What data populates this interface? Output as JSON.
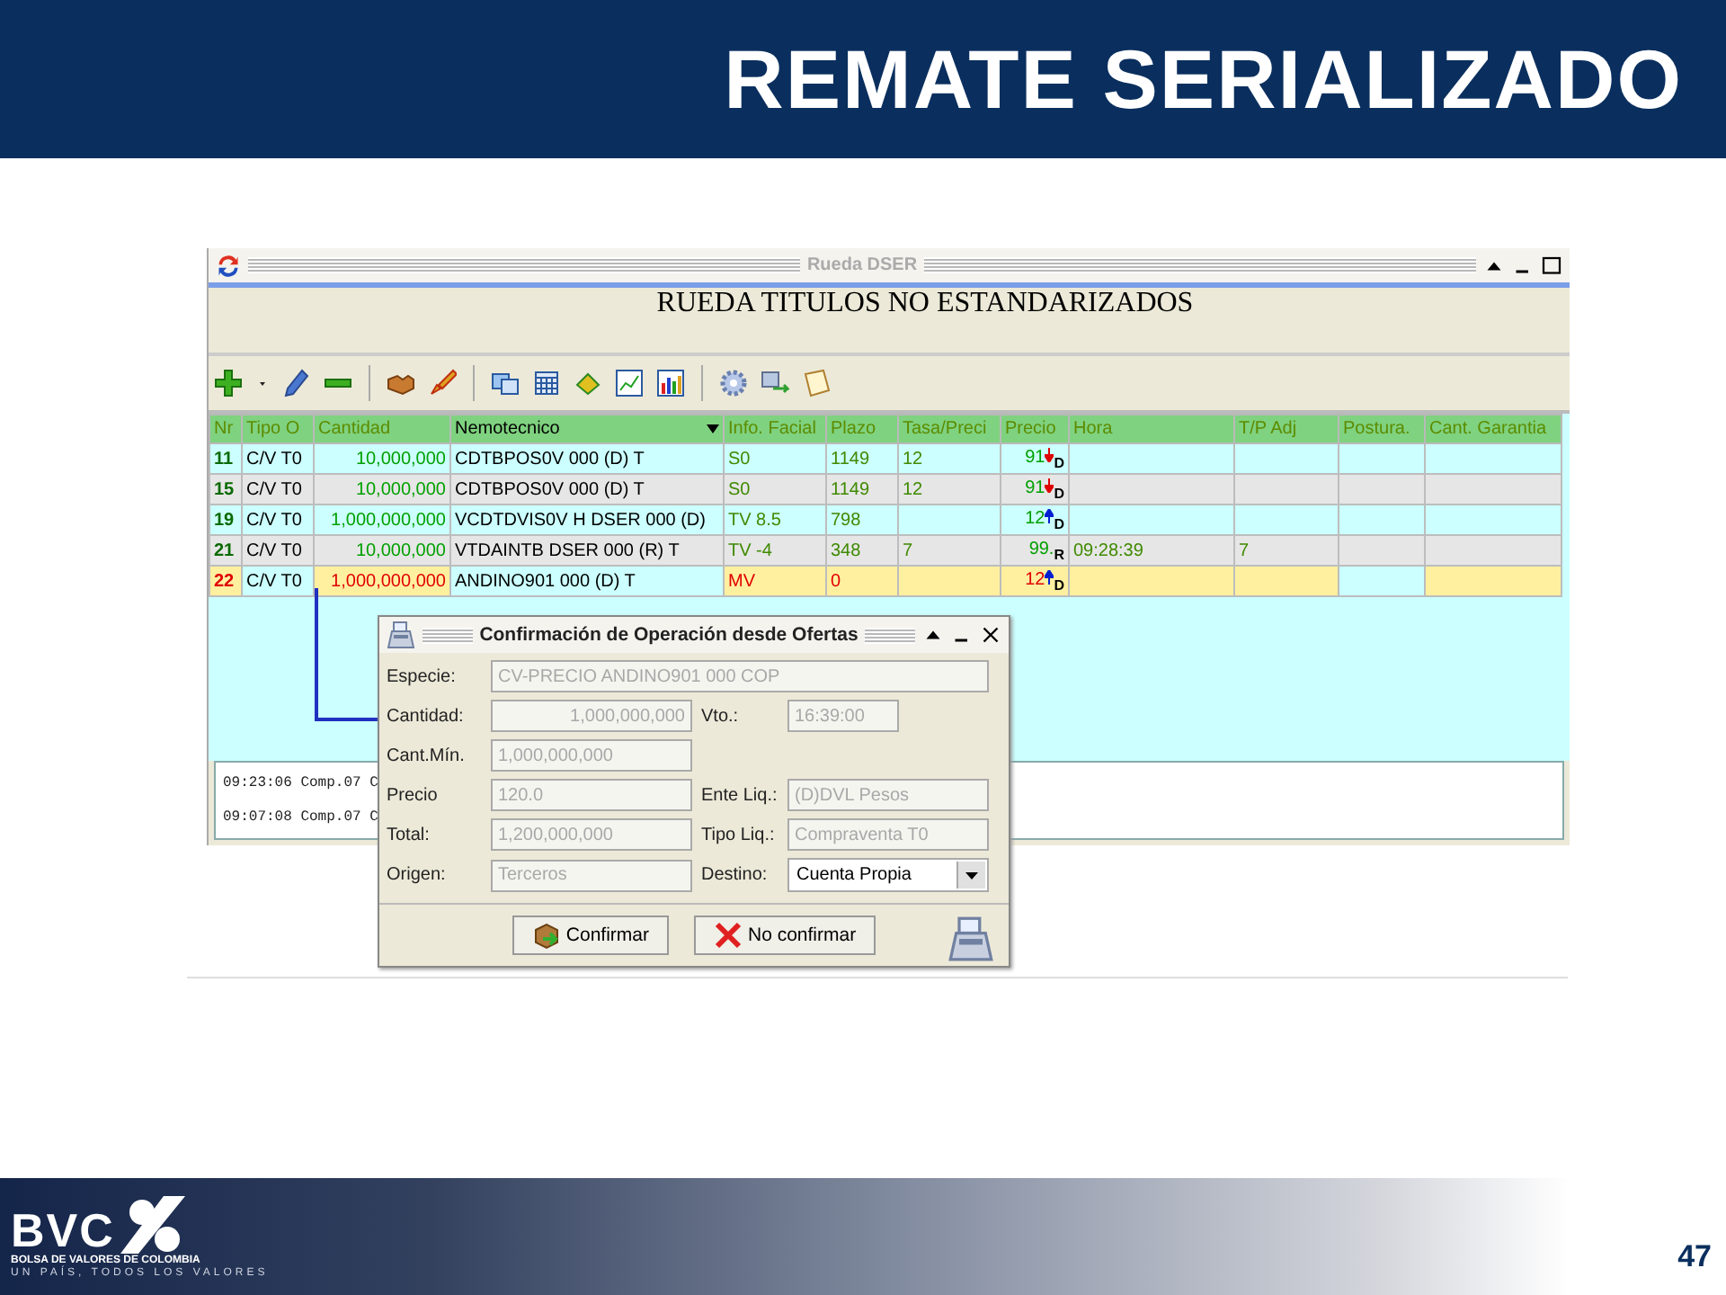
{
  "slide": {
    "title": "REMATE SERIALIZADO",
    "page_number": "47"
  },
  "logo": {
    "name": "BVC",
    "tagline": "BOLSA DE VALORES DE COLOMBIA",
    "motto": "UN PAÍS, TODOS LOS VALORES"
  },
  "window": {
    "title": "Rueda DSER",
    "heading": "RUEDA TITULOS NO ESTANDARIZADOS"
  },
  "table": {
    "columns": [
      {
        "label": "Nr",
        "sorted": false
      },
      {
        "label": "Tipo O",
        "sorted": false
      },
      {
        "label": "Cantidad",
        "sorted": false
      },
      {
        "label": "Nemotecnico",
        "sorted": true
      },
      {
        "label": "Info. Facial",
        "sorted": false
      },
      {
        "label": "Plazo",
        "sorted": false
      },
      {
        "label": "Tasa/Preci",
        "sorted": false
      },
      {
        "label": "Precio",
        "sorted": false
      },
      {
        "label": "Hora",
        "sorted": false
      },
      {
        "label": "T/P Adj",
        "sorted": false
      },
      {
        "label": "Postura.",
        "sorted": false
      },
      {
        "label": "Cant. Garantia",
        "sorted": false
      }
    ],
    "rows": [
      {
        "selected": false,
        "nro": "11",
        "tipo": "C/V T0",
        "cantidad": "10,000,000",
        "nemotecnico": "CDTBPOS0V 000 (D) T",
        "info": "S0",
        "plazo": "1149",
        "tasa": "12",
        "precio": "91",
        "price_rising": false,
        "flag": "D"
      },
      {
        "selected": false,
        "nro": "15",
        "tipo": "C/V T0",
        "cantidad": "10,000,000",
        "nemotecnico": "CDTBPOS0V 000 (D) T",
        "info": "S0",
        "plazo": "1149",
        "tasa": "12",
        "precio": "91",
        "price_rising": false,
        "flag": "D"
      },
      {
        "selected": false,
        "nro": "19",
        "tipo": "C/V T0",
        "cantidad": "1,000,000,000",
        "nemotecnico": "VCDTDVIS0V H DSER 000 (D)",
        "info": "TV 8.5",
        "plazo": "798",
        "precio": "12",
        "price_rising": true,
        "flag": "D"
      },
      {
        "selected": false,
        "nro": "21",
        "tipo": "C/V T0",
        "cantidad": "10,000,000",
        "nemotecnico": "VTDAINTB DSER 000 (R) T",
        "info": "TV -4",
        "plazo": "348",
        "tasa": "7",
        "precio": "99.",
        "flag": "R",
        "hora": "09:28:39",
        "tp_adj": "7"
      },
      {
        "selected": true,
        "nro": "22",
        "tipo": "C/V T0",
        "cantidad": "1,000,000,000",
        "nemotecnico": "ANDINO901 000 (D) T",
        "info": "MV",
        "plazo": "0",
        "precio": "12",
        "price_rising": true,
        "flag": "D"
      }
    ]
  },
  "log": [
    "09:23:06 Comp.07 C",
    "09:07:08 Comp.07 C"
  ],
  "dialog": {
    "title": "Confirmación de Operación desde Ofertas",
    "rows": [
      [
        {
          "label": "Especie:",
          "value": "CV-PRECIO ANDINO901 000 COP",
          "kind": "wide",
          "disabled": true
        }
      ],
      [
        {
          "label": "Cantidad:",
          "value": "1,000,000,000",
          "kind": "numeric",
          "disabled": true
        },
        {
          "label": "Vto.:",
          "value": "16:39:00",
          "kind": "short",
          "disabled": true
        }
      ],
      [
        {
          "label": "Cant.Mín.",
          "value": "1,000,000,000",
          "kind": "text",
          "disabled": true
        }
      ],
      [
        {
          "label": "Precio",
          "value": "120.0",
          "kind": "text",
          "disabled": true
        },
        {
          "label": "Ente Liq.:",
          "value": "(D)DVL Pesos",
          "kind": "text",
          "disabled": true
        }
      ],
      [
        {
          "label": "Total:",
          "value": "1,200,000,000",
          "kind": "text",
          "disabled": true
        },
        {
          "label": "Tipo Liq.:",
          "value": "Compraventa T0",
          "kind": "text",
          "disabled": true
        }
      ],
      [
        {
          "label": "Origen:",
          "value": "Terceros",
          "kind": "text",
          "disabled": true
        },
        {
          "label": "Destino:",
          "value": "Cuenta Propia",
          "kind": "select",
          "disabled": false
        }
      ]
    ],
    "buttons": [
      {
        "label": "Confirmar",
        "kind": "confirm"
      },
      {
        "label": "No confirmar",
        "kind": "cancel"
      }
    ]
  }
}
